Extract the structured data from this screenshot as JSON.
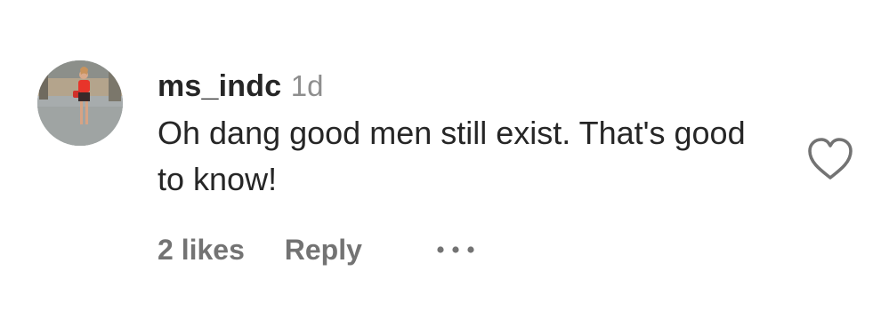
{
  "comment": {
    "username": "ms_indc",
    "time": "1d",
    "text": "Oh dang good men still exist. That's good to know!",
    "likes": "2 likes",
    "reply_label": "Reply",
    "more_icon": "more-options-icon",
    "like_icon": "heart-icon",
    "avatar_icon": "user-avatar-photo"
  },
  "colors": {
    "text_primary": "#262626",
    "text_secondary": "#8e8e8e",
    "action_text": "#737373"
  }
}
